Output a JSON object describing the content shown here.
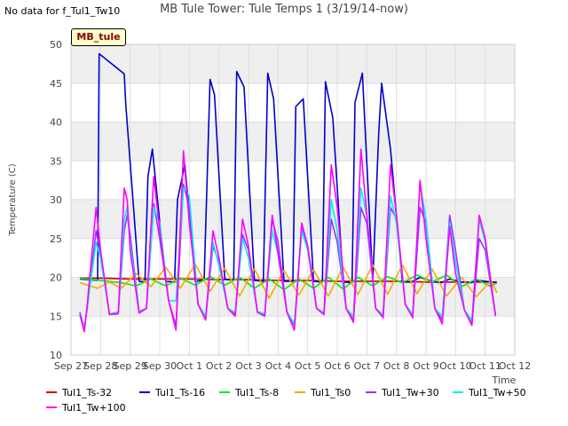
{
  "header": {
    "title": "MB Tule Tower: Tule Temps 1 (3/19/14-now)",
    "nodata_note": "No data for f_Tul1_Tw10",
    "site_label": "MB_tule"
  },
  "colors": {
    "plot_bg_band": "#efefef",
    "grid": "#dddddd",
    "frame": "#cccccc"
  },
  "chart_data": {
    "type": "line",
    "title": "MB Tule Tower: Tule Temps 1 (3/19/14-now)",
    "xlabel": "Time",
    "ylabel": "Temperature (C)",
    "ylim": [
      10,
      50
    ],
    "yticks": [
      10,
      15,
      20,
      25,
      30,
      35,
      40,
      45,
      50
    ],
    "xlim": [
      0,
      15
    ],
    "xtick_values": [
      0,
      1,
      2,
      3,
      4,
      5,
      6,
      7,
      8,
      9,
      10,
      11,
      12,
      13,
      14,
      15
    ],
    "xtick_labels": [
      "Sep 27",
      "Sep 28",
      "Sep 29",
      "Sep 30",
      "Oct 1",
      "Oct 2",
      "Oct 3",
      "Oct 4",
      "Oct 5",
      "Oct 6",
      "Oct 7",
      "Oct 8",
      "Oct 9",
      "Oct 10",
      "Oct 11",
      "Oct 12"
    ],
    "grid": true,
    "legend_position": "bottom",
    "series": [
      {
        "name": "Tul1_Ts-32",
        "color": "#cc0000",
        "x": [
          0.3,
          1.0,
          2.0,
          3.0,
          4.0,
          5.0,
          6.0,
          7.0,
          8.0,
          9.0,
          10.0,
          11.0,
          12.0,
          13.0,
          14.0,
          14.4
        ],
        "y": [
          19.9,
          19.9,
          19.8,
          19.8,
          19.8,
          19.7,
          19.7,
          19.6,
          19.6,
          19.5,
          19.5,
          19.5,
          19.4,
          19.4,
          19.4,
          19.4
        ]
      },
      {
        "name": "Tul1_Ts-16",
        "color": "#0000cc",
        "x": [
          0.3,
          0.9,
          0.95,
          1.8,
          1.85,
          2.3,
          2.5,
          2.6,
          2.75,
          3.2,
          3.5,
          3.6,
          3.85,
          4.2,
          4.5,
          4.7,
          4.85,
          5.2,
          5.5,
          5.6,
          5.85,
          6.2,
          6.5,
          6.65,
          6.85,
          7.2,
          7.5,
          7.6,
          7.85,
          8.2,
          8.5,
          8.6,
          8.85,
          9.2,
          9.5,
          9.6,
          9.85,
          10.2,
          10.4,
          10.5,
          10.8,
          11.2,
          11.5,
          11.8,
          12.2,
          12.5,
          12.8,
          13.2,
          13.5,
          13.8,
          14.2,
          14.4
        ],
        "y": [
          19.8,
          19.6,
          48.8,
          46.2,
          42.3,
          19.5,
          19.4,
          33.0,
          36.5,
          19.5,
          19.4,
          30.0,
          34.5,
          19.5,
          19.6,
          45.5,
          43.5,
          19.8,
          19.6,
          46.5,
          44.5,
          19.6,
          19.5,
          46.3,
          43.0,
          19.5,
          19.5,
          42.0,
          43.0,
          19.5,
          19.4,
          45.2,
          40.5,
          19.4,
          19.3,
          42.5,
          46.3,
          19.4,
          38.5,
          45.0,
          36.5,
          19.4,
          19.4,
          20.0,
          19.5,
          19.3,
          19.8,
          19.4,
          19.3,
          19.6,
          19.4,
          19.3
        ]
      },
      {
        "name": "Tul1_Ts-8",
        "color": "#00ee00",
        "x": [
          0.3,
          1.0,
          1.7,
          2.2,
          2.7,
          3.2,
          3.7,
          4.2,
          4.7,
          5.2,
          5.7,
          6.2,
          6.7,
          7.2,
          7.7,
          8.2,
          8.7,
          9.2,
          9.7,
          10.2,
          10.7,
          11.2,
          11.7,
          12.2,
          12.7,
          13.2,
          13.7,
          14.2,
          14.4
        ],
        "y": [
          19.9,
          19.6,
          19.3,
          18.9,
          19.8,
          18.9,
          19.9,
          19.0,
          20.1,
          19.0,
          20.0,
          18.6,
          19.8,
          18.4,
          19.8,
          18.6,
          20.0,
          18.5,
          20.0,
          18.9,
          20.1,
          19.3,
          20.3,
          19.4,
          20.3,
          18.8,
          19.8,
          18.8,
          19.3
        ]
      },
      {
        "name": "Tul1_Ts0",
        "color": "#ffa500",
        "x": [
          0.3,
          0.9,
          1.3,
          1.7,
          2.2,
          2.7,
          3.2,
          3.7,
          4.2,
          4.7,
          5.2,
          5.7,
          6.2,
          6.7,
          7.2,
          7.7,
          8.2,
          8.7,
          9.2,
          9.7,
          10.2,
          10.7,
          11.2,
          11.7,
          12.2,
          12.7,
          13.2,
          13.7,
          14.2,
          14.4
        ],
        "y": [
          19.3,
          18.6,
          19.4,
          18.6,
          20.5,
          18.8,
          21.3,
          18.6,
          21.7,
          18.2,
          21.2,
          17.6,
          21.1,
          17.3,
          20.9,
          17.7,
          21.0,
          17.6,
          21.3,
          17.8,
          21.6,
          17.8,
          21.6,
          17.9,
          21.1,
          17.6,
          20.0,
          17.5,
          19.6,
          18.0
        ]
      },
      {
        "name": "Tul1_Tw+30",
        "color": "#9933ff",
        "x": [
          0.3,
          0.45,
          0.55,
          0.85,
          1.0,
          1.3,
          1.6,
          1.8,
          1.9,
          2.0,
          2.3,
          2.55,
          2.8,
          3.0,
          3.3,
          3.55,
          3.8,
          4.0,
          4.3,
          4.55,
          4.8,
          5.0,
          5.3,
          5.55,
          5.8,
          6.0,
          6.3,
          6.55,
          6.8,
          7.0,
          7.3,
          7.55,
          7.8,
          8.0,
          8.3,
          8.55,
          8.8,
          9.0,
          9.3,
          9.55,
          9.8,
          10.0,
          10.3,
          10.55,
          10.8,
          11.0,
          11.3,
          11.55,
          11.8,
          12.0,
          12.3,
          12.55,
          12.8,
          13.0,
          13.3,
          13.55,
          13.8,
          14.0,
          14.35
        ],
        "y": [
          15.5,
          13.5,
          16.0,
          26.0,
          23.0,
          15.3,
          15.5,
          26.0,
          28.0,
          25.5,
          15.6,
          16.0,
          29.5,
          25.0,
          17.0,
          13.8,
          32.0,
          29.0,
          16.5,
          14.8,
          24.0,
          22.0,
          16.0,
          15.3,
          25.5,
          23.5,
          15.6,
          15.2,
          27.5,
          24.5,
          15.6,
          13.8,
          26.5,
          24.0,
          16.0,
          15.3,
          27.5,
          24.5,
          16.0,
          14.5,
          29.0,
          27.0,
          16.0,
          15.0,
          29.0,
          27.5,
          16.5,
          15.0,
          29.0,
          27.0,
          16.0,
          14.5,
          28.0,
          23.5,
          15.8,
          14.0,
          25.0,
          23.5,
          15.2
        ]
      },
      {
        "name": "Tul1_Tw+50",
        "color": "#00eeee",
        "x": [
          0.3,
          0.45,
          0.55,
          0.85,
          1.0,
          1.3,
          1.6,
          1.8,
          1.9,
          2.0,
          2.3,
          2.55,
          2.8,
          3.0,
          3.3,
          3.55,
          3.8,
          4.0,
          4.3,
          4.55,
          4.8,
          5.0,
          5.3,
          5.55,
          5.8,
          6.0,
          6.3,
          6.55,
          6.8,
          7.0,
          7.3,
          7.55,
          7.8,
          8.0,
          8.3,
          8.55,
          8.8,
          9.0,
          9.3,
          9.55,
          9.8,
          10.0,
          10.3,
          10.55,
          10.8,
          11.0,
          11.3,
          11.55,
          11.8,
          12.0,
          12.3,
          12.55,
          12.8,
          13.0,
          13.3,
          13.55,
          13.8,
          14.0,
          14.35
        ],
        "y": [
          15.3,
          13.4,
          16.2,
          24.5,
          22.5,
          15.3,
          15.4,
          27.5,
          29.0,
          24.5,
          15.5,
          16.0,
          29.0,
          27.0,
          17.0,
          17.0,
          31.5,
          30.5,
          16.5,
          15.0,
          24.5,
          21.5,
          16.0,
          15.5,
          25.0,
          22.5,
          15.6,
          15.3,
          26.0,
          23.0,
          15.6,
          14.0,
          26.0,
          23.5,
          16.0,
          15.5,
          30.0,
          26.0,
          16.0,
          15.0,
          31.5,
          28.0,
          16.0,
          15.2,
          30.5,
          27.0,
          16.5,
          15.2,
          32.0,
          27.5,
          16.0,
          15.0,
          27.0,
          22.0,
          15.8,
          14.5,
          27.5,
          24.5,
          15.3
        ]
      },
      {
        "name": "Tul1_Tw+100",
        "color": "#ff00ff",
        "x": [
          0.3,
          0.45,
          0.55,
          0.85,
          1.0,
          1.3,
          1.6,
          1.8,
          1.9,
          2.0,
          2.3,
          2.55,
          2.8,
          3.0,
          3.3,
          3.55,
          3.8,
          4.0,
          4.3,
          4.55,
          4.8,
          5.0,
          5.3,
          5.55,
          5.8,
          6.0,
          6.3,
          6.55,
          6.8,
          7.0,
          7.3,
          7.55,
          7.8,
          8.0,
          8.3,
          8.55,
          8.8,
          9.0,
          9.3,
          9.55,
          9.8,
          10.0,
          10.3,
          10.55,
          10.8,
          11.0,
          11.3,
          11.55,
          11.8,
          12.0,
          12.3,
          12.55,
          12.8,
          13.0,
          13.3,
          13.55,
          13.8,
          14.0,
          14.35
        ],
        "y": [
          15.2,
          13.0,
          16.5,
          29.0,
          23.5,
          15.2,
          15.3,
          31.5,
          30.0,
          23.5,
          15.4,
          16.0,
          33.0,
          26.0,
          17.0,
          13.2,
          36.3,
          27.0,
          16.5,
          14.5,
          26.0,
          22.5,
          16.0,
          15.0,
          27.5,
          24.0,
          15.5,
          15.0,
          28.0,
          23.0,
          15.5,
          13.2,
          27.0,
          24.0,
          16.0,
          15.2,
          34.5,
          29.0,
          16.0,
          14.2,
          36.5,
          28.0,
          16.0,
          14.8,
          34.5,
          28.0,
          16.5,
          14.8,
          32.5,
          25.0,
          16.0,
          14.0,
          26.5,
          20.5,
          15.8,
          13.8,
          28.0,
          25.0,
          15.0
        ]
      }
    ]
  }
}
